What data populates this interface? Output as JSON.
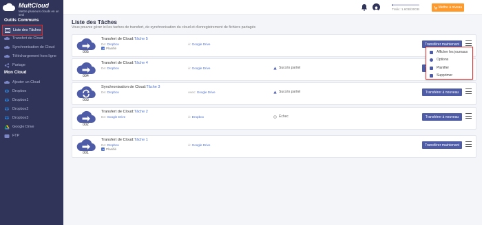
{
  "brand": {
    "name": "MultCloud",
    "tagline": "Mettre plusieurs clouds en un seul"
  },
  "sidebar": {
    "section_common": "Outils Communs",
    "section_mycloud": "Mon Cloud",
    "common_items": [
      {
        "label": "Liste des Tâches",
        "icon": "task-list-icon",
        "active": true
      },
      {
        "label": "Transfert de Cloud",
        "icon": "cloud-transfer-icon"
      },
      {
        "label": "Synchronisation de Cloud",
        "icon": "cloud-sync-icon"
      },
      {
        "label": "Téléchargement hors ligne",
        "icon": "download-icon"
      },
      {
        "label": "Partage",
        "icon": "share-icon"
      }
    ],
    "cloud_items": [
      {
        "label": "Ajouter un Cloud",
        "icon": "add-cloud-icon"
      },
      {
        "label": "Dropbox",
        "icon": "dropbox-icon"
      },
      {
        "label": "Dropbox1",
        "icon": "dropbox-icon"
      },
      {
        "label": "Dropbox2",
        "icon": "dropbox-icon"
      },
      {
        "label": "Dropbox3",
        "icon": "dropbox-icon"
      },
      {
        "label": "Google Drive",
        "icon": "google-drive-icon"
      },
      {
        "label": "FTP",
        "icon": "ftp-icon"
      }
    ]
  },
  "topbar": {
    "traffic_label": "Trafic: 1.6GB/30GB",
    "traffic_fraction": 0.05,
    "upgrade_label": "Mettre à niveau"
  },
  "main": {
    "title": "Liste des Tâches",
    "description": "Vous pouvez gérer ici les taches de transfert, de synchronisation du cloud et d'enregistrement de fichiers partagés"
  },
  "tasks": [
    {
      "num": "005",
      "type": "Transfert de Cloud:",
      "task": "Tâche 5",
      "src_label": "De:",
      "src": "Dropbox",
      "dst_label": "À:",
      "dst": "Google Drive",
      "planned": true,
      "plan_label": "Planifié",
      "status": "",
      "action": "Transférer maintenant",
      "icon": "cloud-transfer-icon"
    },
    {
      "num": "004",
      "type": "Transfert de Cloud:",
      "task": "Tâche 4",
      "src_label": "De:",
      "src": "Dropbox",
      "dst_label": "À:",
      "dst": "Google Drive",
      "planned": false,
      "plan_label": "",
      "status": "Succès partiel",
      "action": "Transférer maintenant",
      "icon": "cloud-transfer-icon"
    },
    {
      "num": "003",
      "type": "Synchronisation de Cloud:",
      "task": "Tâche 3",
      "src_label": "De:",
      "src": "Dropbox",
      "dst_label": "Avec:",
      "dst": "Google Drive",
      "planned": false,
      "plan_label": "",
      "status": "Succès partiel",
      "action": "Transférer à nouveau",
      "icon": "cloud-sync-icon"
    },
    {
      "num": "002",
      "type": "Transfert de Cloud:",
      "task": "Tâche 2",
      "src_label": "De:",
      "src": "Google Drive",
      "dst_label": "À:",
      "dst": "Dropbox",
      "planned": false,
      "plan_label": "",
      "status": "Échec",
      "action": "Transférer à nouveau",
      "icon": "cloud-transfer-icon"
    },
    {
      "num": "001",
      "type": "Transfert de Cloud:",
      "task": "Tâche 1",
      "src_label": "De:",
      "src": "Dropbox",
      "dst_label": "À:",
      "dst": "Google Drive",
      "planned": true,
      "plan_label": "Planifié",
      "status": "",
      "action": "Transférer maintenant",
      "icon": "cloud-transfer-icon"
    }
  ],
  "dropdown": {
    "items": [
      {
        "label": "Afficher les journaux",
        "icon": "log-icon"
      },
      {
        "label": "Options",
        "icon": "options-icon"
      },
      {
        "label": "Planifier",
        "icon": "schedule-icon"
      },
      {
        "label": "Supprimer",
        "icon": "delete-icon"
      }
    ]
  },
  "colors": {
    "sidebar_bg": "#2f3458",
    "accent": "#4e5ca8",
    "upgrade": "#ff9a2a",
    "highlight": "#e02b2b",
    "cloud": "#4e5ca8"
  }
}
